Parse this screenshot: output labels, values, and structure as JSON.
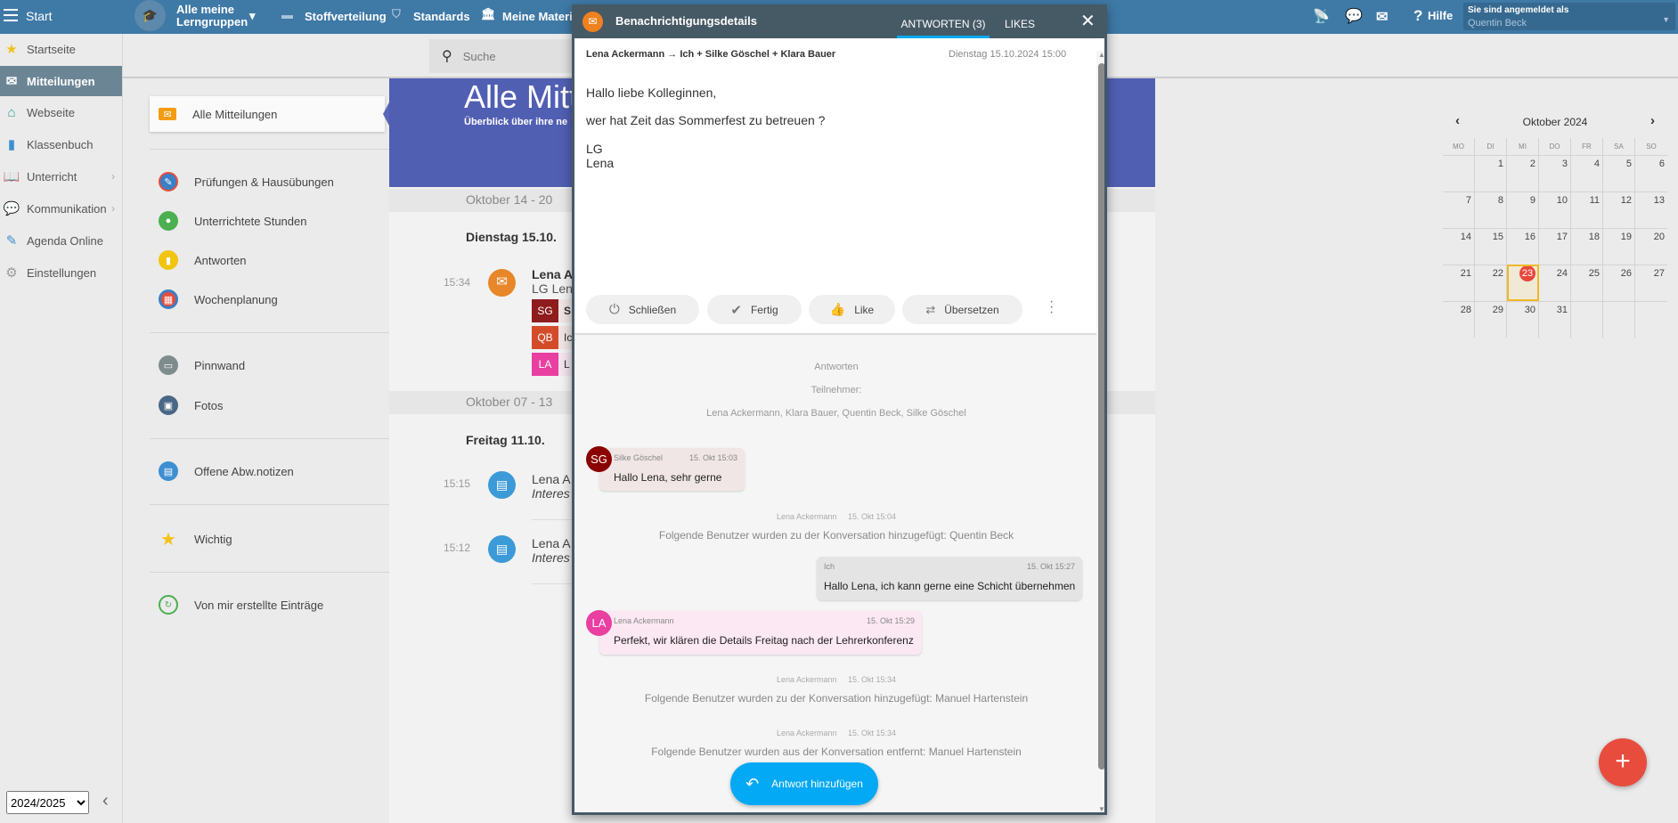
{
  "topbar": {
    "start": "Start",
    "group_line1": "Alle meine",
    "group_line2": "Lerngruppen",
    "stoffverteilung": "Stoffverteilung",
    "standards": "Standards",
    "materialien": "Meine Materia",
    "hilfe": "Hilfe",
    "logged_in_label": "Sie sind angemeldet als",
    "user": "Quentin Beck"
  },
  "leftnav": {
    "items": [
      {
        "label": "Startseite"
      },
      {
        "label": "Mitteilungen"
      },
      {
        "label": "Webseite"
      },
      {
        "label": "Klassenbuch"
      },
      {
        "label": "Unterricht"
      },
      {
        "label": "Kommunikation"
      },
      {
        "label": "Agenda Online"
      },
      {
        "label": "Einstellungen"
      }
    ],
    "year": "2024/2025"
  },
  "search": {
    "placeholder": "Suche"
  },
  "panel": {
    "items": [
      {
        "label": "Alle Mitteilungen"
      },
      {
        "label": "Prüfungen & Hausübungen"
      },
      {
        "label": "Unterrichtete Stunden"
      },
      {
        "label": "Antworten"
      },
      {
        "label": "Wochenplanung"
      },
      {
        "label": "Pinnwand"
      },
      {
        "label": "Fotos"
      },
      {
        "label": "Offene Abw.notizen"
      },
      {
        "label": "Wichtig"
      },
      {
        "label": "Von mir erstellte Einträge"
      }
    ]
  },
  "main": {
    "title": "Alle Mitte",
    "subtitle": "Überblick über ihre ne",
    "weeks": [
      {
        "label": "Oktober 14 - 20",
        "day": "Dienstag 15.10.",
        "items": [
          {
            "time": "15:34",
            "name": "Lena A",
            "preview": "LG Len",
            "tags": [
              {
                "initials": "SG",
                "text": "S"
              },
              {
                "initials": "QB",
                "text": "Ic"
              },
              {
                "initials": "LA",
                "text": "L"
              }
            ]
          }
        ]
      },
      {
        "label": "Oktober 07 - 13",
        "day": "Freitag 11.10.",
        "items": [
          {
            "time": "15:15",
            "name": "Lena A",
            "preview": "Interes"
          },
          {
            "time": "15:12",
            "name": "Lena A",
            "preview": "Interes"
          }
        ]
      }
    ]
  },
  "modal": {
    "title": "Benachrichtigungsdetails",
    "tab_answers": "ANTWORTEN (3)",
    "tab_likes": "LIKES",
    "sender_line": "Lena Ackermann → Ich + Silke Göschel + Klara Bauer",
    "date": "Dienstag 15.10.2024 15:00",
    "body": [
      "Hallo liebe Kolleginnen,",
      "wer hat Zeit das Sommerfest zu betreuen ?",
      "LG",
      "Lena"
    ],
    "buttons": {
      "close": "Schließen",
      "done": "Fertig",
      "like": "Like",
      "translate": "Übersetzen"
    },
    "answers_label": "Antworten",
    "participants_label": "Teilnehmer:",
    "participants": "Lena Ackermann, Klara Bauer, Quentin Beck, Silke Göschel",
    "messages": [
      {
        "initials": "SG",
        "author": "Silke Göschel",
        "time": "15. Okt 15:03",
        "text": "Hallo Lena, sehr gerne"
      },
      {
        "author": "Lena Ackermann",
        "time": "15. Okt 15:04",
        "text": "Folgende Benutzer wurden zu der Konversation hinzugefügt: Quentin Beck"
      },
      {
        "author": "Ich",
        "time": "15. Okt 15:27",
        "text": "Hallo Lena, ich kann gerne eine Schicht übernehmen"
      },
      {
        "initials": "LA",
        "author": "Lena Ackermann",
        "time": "15. Okt 15:29",
        "text": "Perfekt, wir klären die Details Freitag nach der Lehrerkonferenz"
      },
      {
        "author": "Lena Ackermann",
        "time": "15. Okt 15:34",
        "text": "Folgende Benutzer wurden zu der Konversation hinzugefügt: Manuel Hartenstein"
      },
      {
        "author": "Lena Ackermann",
        "time": "15. Okt 15:34",
        "text": "Folgende Benutzer wurden aus der Konversation entfernt: Manuel Hartenstein"
      }
    ],
    "reply_button": "Antwort hinzufügen"
  },
  "calendar": {
    "title": "Oktober 2024",
    "weekdays": [
      "MO",
      "DI",
      "MI",
      "DO",
      "FR",
      "SA",
      "SO"
    ],
    "today": 23,
    "first_offset": 1,
    "days": 31
  },
  "colors": {
    "topbar": "#3f79a6",
    "modal_header": "#465a66",
    "hero": "#515fb3",
    "accent": "#03a9f4",
    "fab": "#e84c3d"
  }
}
